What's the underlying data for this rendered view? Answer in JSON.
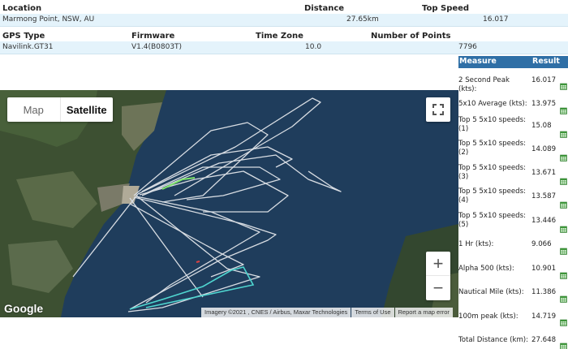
{
  "info": {
    "row1_headers": {
      "location": "Location",
      "distance": "Distance",
      "top_speed": "Top Speed"
    },
    "row1_values": {
      "location": "Marmong Point, NSW, AU",
      "distance": "27.65km",
      "top_speed": "16.017"
    },
    "row2_headers": {
      "gps_type": "GPS Type",
      "firmware": "Firmware",
      "time_zone": "Time Zone",
      "num_points": "Number of Points"
    },
    "row2_values": {
      "gps_type": "Navilink.GT31",
      "firmware": "V1.4(B0803T)",
      "time_zone": "10.0",
      "num_points": "7796"
    }
  },
  "map": {
    "map_label": "Map",
    "satellite_label": "Satellite",
    "zoom_in": "+",
    "zoom_out": "−",
    "logo": "Google",
    "imagery": "Imagery ©2021 , CNES / Airbus, Maxar Technologies",
    "terms": "Terms of Use",
    "report": "Report a map error"
  },
  "results": {
    "measure_header": "Measure",
    "result_header": "Result",
    "rows": [
      {
        "label": "2 Second Peak (kts):",
        "value": "16.017"
      },
      {
        "label": "5x10 Average (kts):",
        "value": "13.975"
      },
      {
        "label": "Top 5 5x10 speeds: (1)",
        "value": "15.08"
      },
      {
        "label": "Top 5 5x10 speeds: (2)",
        "value": "14.089"
      },
      {
        "label": "Top 5 5x10 speeds: (3)",
        "value": "13.671"
      },
      {
        "label": "Top 5 5x10 speeds: (4)",
        "value": "13.587"
      },
      {
        "label": "Top 5 5x10 speeds: (5)",
        "value": "13.446"
      },
      {
        "label": "1 Hr (kts):",
        "value": "9.066"
      },
      {
        "label": "Alpha 500 (kts):",
        "value": "10.901"
      },
      {
        "label": "Nautical Mile (kts):",
        "value": "11.386"
      },
      {
        "label": "100m peak (kts):",
        "value": "14.719"
      },
      {
        "label": "Total Distance (km):",
        "value": "27.648"
      }
    ]
  }
}
